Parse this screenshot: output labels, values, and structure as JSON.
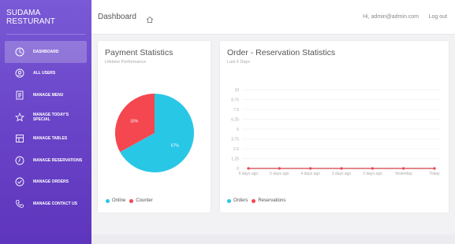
{
  "brand": "SUDAMA RESTURANT",
  "header": {
    "title": "Dashboard",
    "home_icon": "home-icon",
    "greeting": "Hi, admin@admin.com",
    "logout": "Log out"
  },
  "sidebar": {
    "items": [
      {
        "label": "DASHBOARD",
        "icon": "dashboard-icon",
        "active": true
      },
      {
        "label": "ALL USERS",
        "icon": "users-icon",
        "active": false
      },
      {
        "label": "MANAGE MENU",
        "icon": "menu-list-icon",
        "active": false
      },
      {
        "label": "MANAGE TODAY'S SPECIAL",
        "icon": "star-icon",
        "active": false
      },
      {
        "label": "MANAGE TABLES",
        "icon": "tables-icon",
        "active": false
      },
      {
        "label": "MANAGE RESERVATIONS",
        "icon": "clock-icon",
        "active": false
      },
      {
        "label": "MANAGE ORDERS",
        "icon": "check-circle-icon",
        "active": false
      },
      {
        "label": "MANAGE CONTACT US",
        "icon": "phone-icon",
        "active": false
      }
    ]
  },
  "payment": {
    "title": "Payment Statistics",
    "subtitle": "Lifetime Performance"
  },
  "orders": {
    "title": "Order - Reservation Statistics",
    "subtitle": "Last 6 Days"
  },
  "chart_data": [
    {
      "type": "pie",
      "slices": [
        {
          "label": "Online",
          "value": 67,
          "text": "67%",
          "color": "#29c7e6"
        },
        {
          "label": "Counter",
          "value": 33,
          "text": "33%",
          "color": "#f4474f"
        }
      ],
      "legend": [
        "Online",
        "Counter"
      ],
      "legend_position": "bottom-left"
    },
    {
      "type": "line",
      "categories": [
        "6 days ago",
        "5 days ago",
        "4 days ago",
        "3 days ago",
        "2 days ago",
        "Yesterday",
        "Today"
      ],
      "series": [
        {
          "name": "Orders",
          "values": [
            0,
            0,
            0,
            0,
            0,
            0,
            0
          ],
          "color": "#29c7e6"
        },
        {
          "name": "Reservations",
          "values": [
            0,
            0,
            0,
            0,
            0,
            0,
            0
          ],
          "color": "#f4474f"
        }
      ],
      "yticks": [
        "10",
        "8.75",
        "7.5",
        "6.25",
        "5",
        "3.75",
        "2.5",
        "1.25",
        "0"
      ],
      "ylim": [
        0,
        10
      ],
      "grid": true,
      "legend_position": "bottom-left"
    }
  ]
}
